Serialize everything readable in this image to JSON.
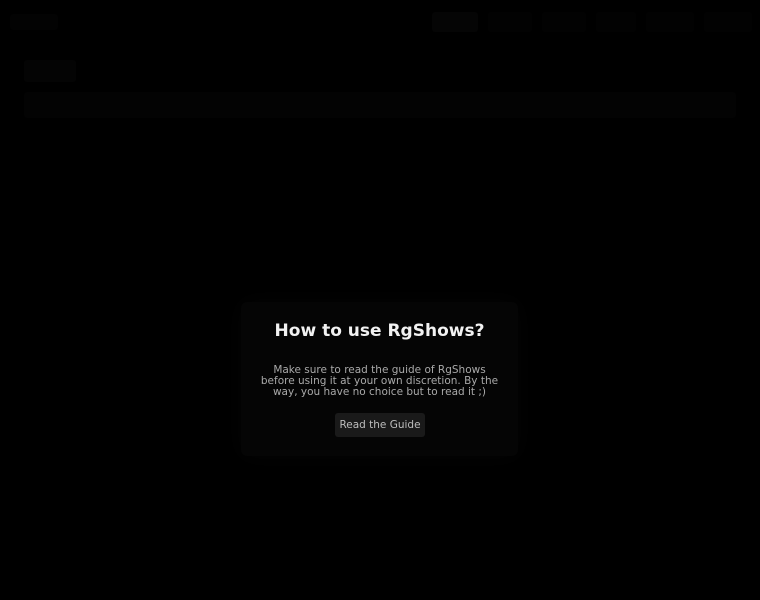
{
  "modal": {
    "title": "How to use RgShows?",
    "body": "Make sure to read the guide of RgShows before using it at your own discretion. By the way, you have no choice but to read it ;)",
    "button_label": "Read the Guide"
  }
}
